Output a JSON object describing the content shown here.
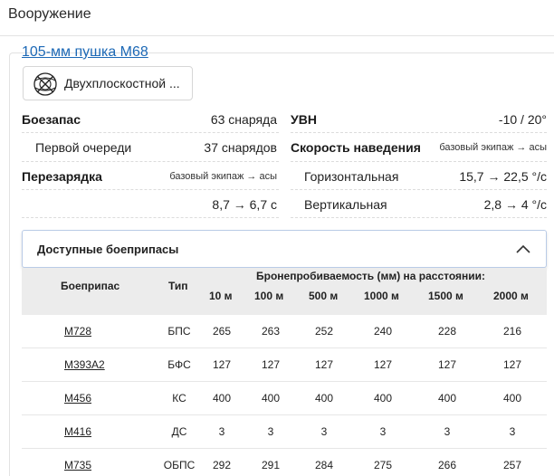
{
  "section": {
    "title": "Вооружение"
  },
  "weapon": {
    "name": "105-мм пушка M68",
    "modification_button": {
      "label": "Двухплоскостной ...",
      "icon": "stabilizer-icon"
    }
  },
  "stats_left": {
    "ammo_label": "Боезапас",
    "ammo_value": "63 снаряда",
    "first_stage_label": "Первой очереди",
    "first_stage_value": "37 снарядов",
    "reload_label": "Перезарядка",
    "reload_note": "базовый экипаж → асы",
    "reload_value": "8,7 → 6,7 с"
  },
  "stats_right": {
    "vertical_guidance_label": "УВН",
    "vertical_guidance_value": "-10 / 20°",
    "traverse_label": "Скорость наведения",
    "traverse_note": "базовый экипаж → асы",
    "horizontal_label": "Горизонтальная",
    "horizontal_value": "15,7 → 22,5 °/с",
    "vertical_label": "Вертикальная",
    "vertical_value": "2,8 → 4 °/с"
  },
  "ammo": {
    "title": "Доступные боеприпасы",
    "headers": {
      "shell": "Боеприпас",
      "type": "Тип",
      "penetration": "Бронепробиваемость (мм) на расстоянии:",
      "distances": [
        "10 м",
        "100 м",
        "500 м",
        "1000 м",
        "1500 м",
        "2000 м"
      ]
    },
    "rows": [
      {
        "name": "M728",
        "type": "БПС",
        "pen": [
          "265",
          "263",
          "252",
          "240",
          "228",
          "216"
        ]
      },
      {
        "name": "M393A2",
        "type": "БФС",
        "pen": [
          "127",
          "127",
          "127",
          "127",
          "127",
          "127"
        ]
      },
      {
        "name": "M456",
        "type": "КС",
        "pen": [
          "400",
          "400",
          "400",
          "400",
          "400",
          "400"
        ]
      },
      {
        "name": "M416",
        "type": "ДС",
        "pen": [
          "3",
          "3",
          "3",
          "3",
          "3",
          "3"
        ]
      },
      {
        "name": "M735",
        "type": "ОБПС",
        "pen": [
          "292",
          "291",
          "284",
          "275",
          "266",
          "257"
        ]
      }
    ]
  }
}
